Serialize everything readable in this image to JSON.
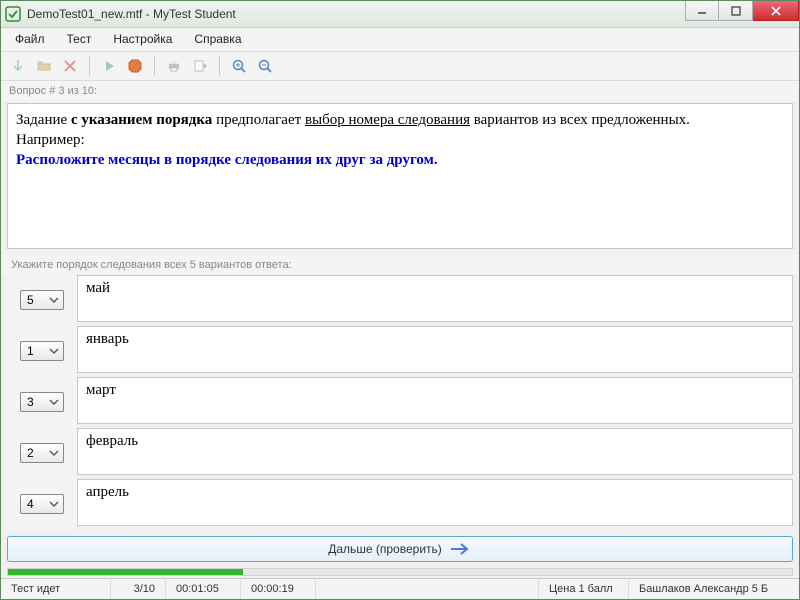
{
  "window": {
    "title": "DemoTest01_new.mtf - MyTest Student"
  },
  "menu": {
    "file": "Файл",
    "test": "Тест",
    "settings": "Настройка",
    "help": "Справка"
  },
  "question_header": "Вопрос # 3 из 10:",
  "question": {
    "line1_a": "Задание ",
    "line1_b": "с указанием порядка",
    "line1_c": " предполагает ",
    "line1_d": "выбор номера следования",
    "line1_e": " вариантов из всех предложенных.",
    "line2": "Например:",
    "line3": "Расположите месяцы в порядке следования их друг за другом."
  },
  "hint": "Укажите порядок следования всех 5 вариантов ответа:",
  "answers": [
    {
      "order": "5",
      "text": "май"
    },
    {
      "order": "1",
      "text": "январь"
    },
    {
      "order": "3",
      "text": "март"
    },
    {
      "order": "2",
      "text": "февраль"
    },
    {
      "order": "4",
      "text": "апрель"
    }
  ],
  "next_button": "Дальше (проверить)",
  "progress_percent": 30,
  "status": {
    "state": "Тест идет",
    "position": "3/10",
    "elapsed": "00:01:05",
    "question_time": "00:00:19",
    "score": "Цена 1 балл",
    "author": "Башлаков Александр 5 Б"
  }
}
